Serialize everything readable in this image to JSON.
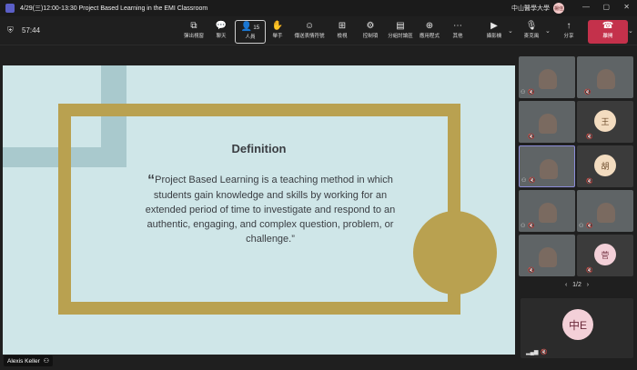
{
  "titlebar": {
    "title": "4/29(三)12:00-13:30 Project Based Learning in the EMI Classroom",
    "org": "中山醫學大學",
    "user_initials": "楊佳",
    "minimize": "—",
    "restore": "▢",
    "close": "✕"
  },
  "toolbar": {
    "timer": "57:44",
    "buttons": [
      {
        "label": "彈出視窗",
        "icon": "⧉"
      },
      {
        "label": "聊天",
        "icon": "💬"
      },
      {
        "label": "人員",
        "icon": "👤",
        "count": "15"
      },
      {
        "label": "舉手",
        "icon": "✋"
      },
      {
        "label": "傳送表情符號",
        "icon": "☺"
      },
      {
        "label": "檢視",
        "icon": "⊞"
      },
      {
        "label": "控制項",
        "icon": "⚙"
      },
      {
        "label": "分組討論區",
        "icon": "▤"
      },
      {
        "label": "應用程式",
        "icon": "⊕"
      },
      {
        "label": "其他",
        "icon": "⋯"
      },
      {
        "label": "攝影機",
        "icon": "▶"
      },
      {
        "label": "麥克風",
        "icon": "🎙"
      },
      {
        "label": "分享",
        "icon": "↑"
      }
    ],
    "leave_label": "離開",
    "leave_icon": "☎"
  },
  "slide": {
    "title": "Definition",
    "quote_mark": "“",
    "body": "Project Based Learning is a teaching method in which students gain knowledge and skills by working for an extended period of time to investigate and respond to an authentic, engaging, and complex question, problem, or challenge.”"
  },
  "presenter": {
    "name": "Alexis Keller"
  },
  "gallery": {
    "tiles": [
      {
        "kind": "video"
      },
      {
        "kind": "video"
      },
      {
        "kind": "video"
      },
      {
        "kind": "avatar",
        "initial": "王"
      },
      {
        "kind": "video"
      },
      {
        "kind": "avatar",
        "initial": "胡"
      },
      {
        "kind": "video"
      },
      {
        "kind": "video"
      },
      {
        "kind": "video"
      },
      {
        "kind": "avatar",
        "initial": "菅"
      }
    ],
    "pager": "1/2",
    "pager_prev": "‹",
    "pager_next": "›",
    "self_initials": "中E",
    "mute_icon": "🔇"
  }
}
